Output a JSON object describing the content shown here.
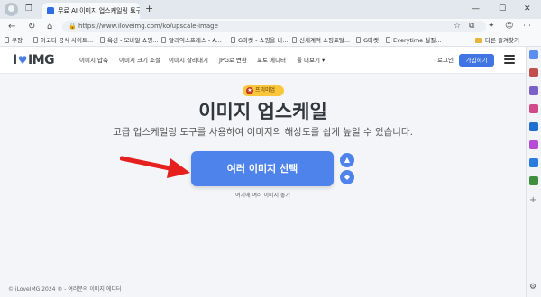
{
  "browser": {
    "tab_title": "무료 AI 이미지 업스케일링 도구",
    "tab_close": "×",
    "new_tab": "+",
    "window_controls": {
      "minimize": "—",
      "maximize": "☐",
      "close": "✕"
    },
    "url": "https://www.iloveimg.com/ko/upscale-image",
    "bookmarks": [
      {
        "label": "쿠팡"
      },
      {
        "label": "아고다 공식 사이트..."
      },
      {
        "label": "옥션 - 모바일 쇼핑..."
      },
      {
        "label": "알리익스프레스 - A..."
      },
      {
        "label": "G마켓 - 쇼핑을 바..."
      },
      {
        "label": "신세계적 쇼핑포털..."
      },
      {
        "label": "G마켓"
      },
      {
        "label": "Everytime 실질..."
      },
      {
        "label": "다른 즐겨찾기"
      }
    ]
  },
  "site": {
    "logo_left": "I",
    "logo_right": "IMG",
    "nav": [
      "이미지 압축",
      "이미지 크기 조절",
      "이미지 잘라내기",
      "JPG로 변환",
      "포토 에디터",
      "툴 더보기 ▾"
    ],
    "login": "로그인",
    "signup": "가입하기",
    "badge": "프리미엄",
    "headline": "이미지 업스케일",
    "subheadline": "고급 업스케일링 도구를 사용하여 이미지의 해상도를 쉽게 높일 수 있습니다.",
    "select_button": "여러 이미지 선택",
    "drop_hint": "여기에 여러 이미지 놓기",
    "footer": "© iLoveIMG 2024 ® - 여러분의 이미지 에디터"
  },
  "colors": {
    "brand": "#4d83ea",
    "badge": "#fcc63c",
    "arrow": "#e5201f"
  }
}
